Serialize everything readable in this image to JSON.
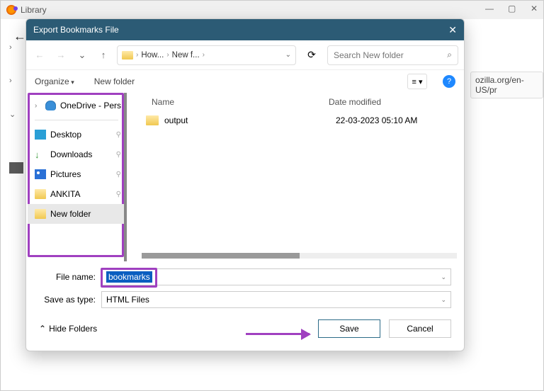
{
  "library": {
    "title": "Library",
    "visible_url": "ozilla.org/en-US/pr"
  },
  "dialog": {
    "title": "Export Bookmarks File",
    "breadcrumbs": [
      "How...",
      "New f..."
    ],
    "search_placeholder": "Search New folder",
    "organize": "Organize",
    "new_folder": "New folder",
    "help": "?",
    "nav": {
      "onedrive": "OneDrive - Pers",
      "desktop": "Desktop",
      "downloads": "Downloads",
      "pictures": "Pictures",
      "ankita": "ANKITA",
      "newfolder": "New folder"
    },
    "columns": {
      "name": "Name",
      "date": "Date modified"
    },
    "rows": [
      {
        "name": "output",
        "date": "22-03-2023 05:10 AM"
      }
    ],
    "filename_label": "File name:",
    "filename_value": "bookmarks",
    "savetype_label": "Save as type:",
    "savetype_value": "HTML Files",
    "hide_folders": "Hide Folders",
    "save": "Save",
    "cancel": "Cancel"
  }
}
